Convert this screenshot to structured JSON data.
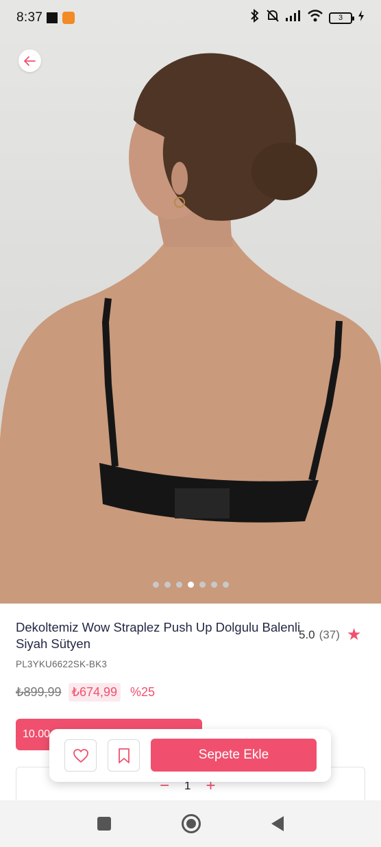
{
  "status_bar": {
    "time": "8:37",
    "battery": "3"
  },
  "gallery": {
    "image": "model-back-view-black-bra",
    "slide_count": 7,
    "active_slide": 4
  },
  "product": {
    "title": "Dekoltemiz Wow Straplez Push Up Dolgulu Balenli Siyah Sütyen",
    "rating": "5.0",
    "review_count": "(37)",
    "sku": "PL3YKU6622SK-BK3",
    "old_price": "₺899,99",
    "new_price": "₺674,99",
    "discount": "%25"
  },
  "promo": {
    "text": "10.00"
  },
  "quantity": {
    "minus": "−",
    "value": "1",
    "plus": "+"
  },
  "actions": {
    "add_to_cart": "Sepete Ekle"
  },
  "colors": {
    "accent": "#f0506e",
    "accent_light": "#fce9ee"
  }
}
